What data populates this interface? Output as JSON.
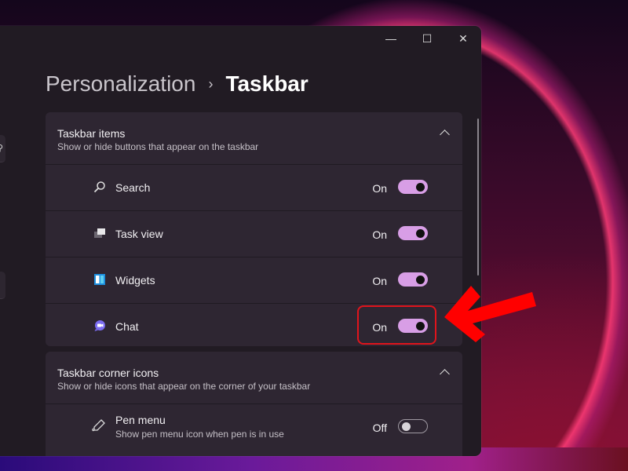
{
  "window": {
    "controls": {
      "minimize": "—",
      "maximize": "☐",
      "close": "✕"
    }
  },
  "breadcrumb": {
    "parent": "Personalization",
    "separator": "›",
    "current": "Taskbar"
  },
  "groups": [
    {
      "title": "Taskbar items",
      "subtitle": "Show or hide buttons that appear on the taskbar",
      "expanded": true,
      "items": [
        {
          "label": "Search",
          "icon": "search-icon",
          "state": "On",
          "on": true
        },
        {
          "label": "Task view",
          "icon": "task-view-icon",
          "state": "On",
          "on": true
        },
        {
          "label": "Widgets",
          "icon": "widgets-icon",
          "state": "On",
          "on": true
        },
        {
          "label": "Chat",
          "icon": "chat-icon",
          "state": "On",
          "on": true
        }
      ]
    },
    {
      "title": "Taskbar corner icons",
      "subtitle": "Show or hide icons that appear on the corner of your taskbar",
      "expanded": true,
      "items": [
        {
          "label": "Pen menu",
          "description": "Show pen menu icon when pen is in use",
          "icon": "pen-icon",
          "state": "Off",
          "on": false
        }
      ]
    }
  ],
  "annotation": {
    "highlight_color": "#e0141c",
    "target": "Chat toggle"
  },
  "colors": {
    "toggle_on": "#d89ee6",
    "panel": "#2e2632",
    "window": "#211b23"
  }
}
